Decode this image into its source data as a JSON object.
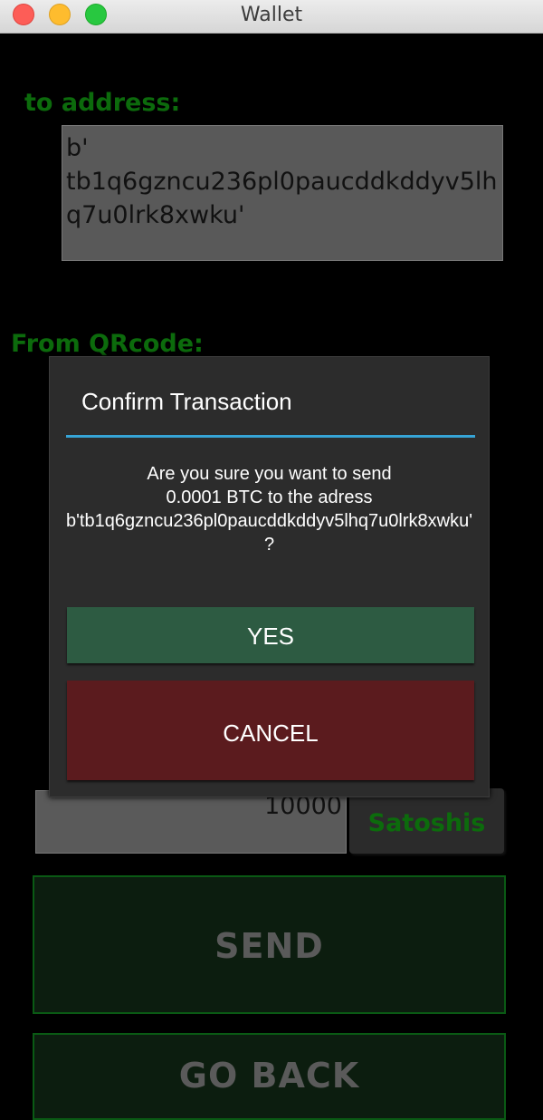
{
  "window": {
    "title": "Wallet"
  },
  "main": {
    "to_address_label": "to address:",
    "address_value": "b'\ntb1q6gzncu236pl0paucddkddyv5lh\nq7u0lrk8xwku'",
    "from_qrcode_label": "From QRcode:",
    "amount_value": "10000",
    "unit_label": "Satoshis",
    "send_label": "SEND",
    "go_back_label": "GO BACK"
  },
  "dialog": {
    "title": "Confirm Transaction",
    "message_lines": [
      "Are you sure you want to send",
      "0.0001 BTC to the adress",
      "b'tb1q6gzncu236pl0paucddkddyv5lhq7u0lrk8xwku'",
      "?"
    ],
    "yes_label": "YES",
    "cancel_label": "CANCEL"
  },
  "colors": {
    "label_green": "#0c6b0c",
    "divider_blue": "#36a4d6",
    "yes_green": "#2d5b42",
    "cancel_red": "#5b1b1e"
  }
}
